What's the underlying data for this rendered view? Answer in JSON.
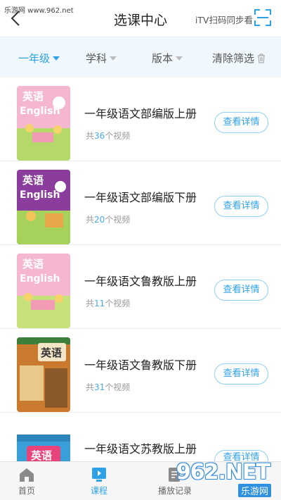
{
  "watermark_top": "乐游网 www.962.net",
  "header": {
    "title": "选课中心",
    "itv_label": "iTV扫码同步看"
  },
  "filters": {
    "grade": "一年级",
    "subject": "学科",
    "edition": "版本",
    "clear": "清除筛选"
  },
  "courses": [
    {
      "title": "一年级语文部编版上册",
      "count_prefix": "共",
      "count": "36",
      "count_suffix": "个视频",
      "button": "查看详情",
      "cover_title": "英语",
      "cover_sub": "English"
    },
    {
      "title": "一年级语文部编版下册",
      "count_prefix": "共",
      "count": "20",
      "count_suffix": "个视频",
      "button": "查看详情",
      "cover_title": "英语",
      "cover_sub": "English"
    },
    {
      "title": "一年级语文鲁教版上册",
      "count_prefix": "共",
      "count": "11",
      "count_suffix": "个视频",
      "button": "查看详情",
      "cover_title": "英语",
      "cover_sub": "English"
    },
    {
      "title": "一年级语文鲁教版下册",
      "count_prefix": "共",
      "count": "31",
      "count_suffix": "个视频",
      "button": "查看详情",
      "cover_title": "英语",
      "cover_sub": ""
    },
    {
      "title": "一年级语文苏教版上册",
      "count_prefix": "",
      "count": "",
      "count_suffix": "",
      "button": "查看详情",
      "cover_title": "英语",
      "cover_sub": ""
    }
  ],
  "tabs": {
    "home": "首页",
    "course": "课程",
    "history": "播放记录"
  },
  "watermark_corner": {
    "big": "962.NET",
    "small": "乐游网"
  },
  "colors": {
    "accent": "#2ea2e6",
    "filter_bg": "#f0f7fd"
  }
}
